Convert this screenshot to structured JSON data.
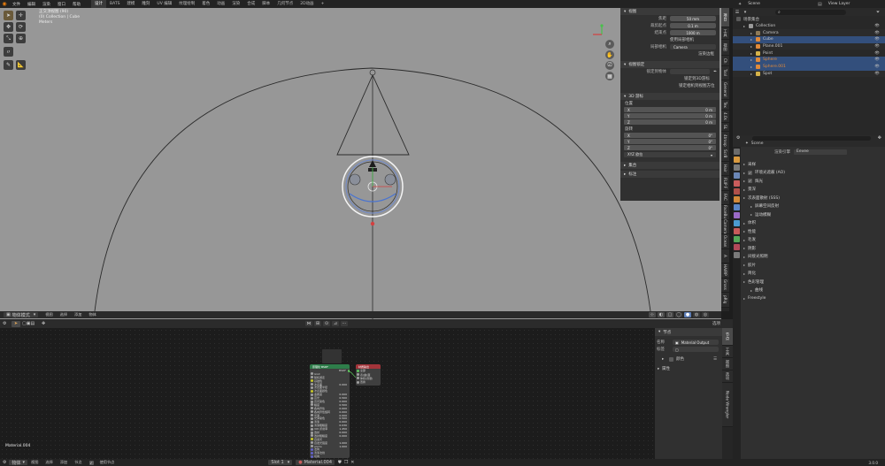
{
  "menu": {
    "logo": "blender-logo",
    "items": [
      "文件",
      "编辑",
      "渲染",
      "窗口",
      "帮助"
    ],
    "workspaces": [
      {
        "label": "设计",
        "active": true
      },
      {
        "label": "BATS",
        "active": false
      },
      {
        "label": "建模",
        "active": false
      },
      {
        "label": "雕刻",
        "active": false
      },
      {
        "label": "UV 编辑",
        "active": false
      },
      {
        "label": "纹理绘制",
        "active": false
      },
      {
        "label": "着色",
        "active": false
      },
      {
        "label": "动画",
        "active": false
      },
      {
        "label": "渲染",
        "active": false
      },
      {
        "label": "合成",
        "active": false
      },
      {
        "label": "脚本",
        "active": false
      },
      {
        "label": "几何节点",
        "active": false
      },
      {
        "label": "2D动画",
        "active": false
      }
    ],
    "add_workspace": "+",
    "scene_name": "Scene",
    "view_layer": "View Layer"
  },
  "viewport": {
    "overlay_lines": [
      "正交顶视图 (90)",
      "(0) Collection | Cube",
      "Meters"
    ],
    "mode_label": "物体模式",
    "header_menus": [
      "视图",
      "选择",
      "添加",
      "物体"
    ],
    "transform_orientation": "全局"
  },
  "npanel": {
    "sections": {
      "view": "视图",
      "view_lock": "视图锁定",
      "cursor": "3D 游标",
      "collections": "集合",
      "annotations": "标注"
    },
    "view_fields": [
      {
        "label": "焦距",
        "value": "50 mm"
      },
      {
        "label": "裁剪起点",
        "value": "0.1 m"
      },
      {
        "label": "结束点",
        "value": "1000 m"
      }
    ],
    "local_camera": "使用局部相机",
    "camera_label": "局部相机",
    "camera_value": "Camera",
    "render_region": "渲染边框",
    "lock_to_object": "锁定到物体",
    "lock_to_cursor": "锁定到3D游标",
    "lock_camera_to_view": "锁定相机到视图方位",
    "location_label": "位置",
    "location": [
      {
        "axis": "X",
        "value": "0 m"
      },
      {
        "axis": "Y",
        "value": "0 m"
      },
      {
        "axis": "Z",
        "value": "0 m"
      }
    ],
    "rotation_label": "旋转",
    "rotation": [
      {
        "axis": "X",
        "value": "0°"
      },
      {
        "axis": "Y",
        "value": "0°"
      },
      {
        "axis": "Z",
        "value": "0°"
      }
    ],
    "rotation_mode": "XYZ 欧拉",
    "tabs": [
      "项目",
      "工具",
      "视图",
      "Ch",
      "Tool",
      "General",
      "Tex",
      "4.0s",
      "SL",
      "4troop"
    ]
  },
  "outliner": {
    "title": "场景集合",
    "items": [
      {
        "label": "Collection",
        "indent": 1,
        "color": "#9a9a9a",
        "selected": false
      },
      {
        "label": "Camera",
        "indent": 2,
        "color": "#8f7a57",
        "selected": false
      },
      {
        "label": "Cube",
        "indent": 2,
        "color": "#e08a3a",
        "selected": true
      },
      {
        "label": "Plane.001",
        "indent": 2,
        "color": "#e08a3a",
        "selected": false
      },
      {
        "label": "Point",
        "indent": 2,
        "color": "#d6b34a",
        "selected": false
      },
      {
        "label": "Sphere",
        "indent": 2,
        "color": "#e08a3a",
        "selected": true
      },
      {
        "label": "Sphere.001",
        "indent": 2,
        "color": "#e08a3a",
        "selected": true
      },
      {
        "label": "Spot",
        "indent": 2,
        "color": "#d6b34a",
        "selected": false
      }
    ]
  },
  "properties": {
    "scene_label": "Scene",
    "engine_label": "渲染引擎",
    "engine_value": "Eevee",
    "rows": [
      {
        "label": "采样",
        "indent": 0,
        "check": false
      },
      {
        "label": "环境光遮蔽 (AO)",
        "indent": 0,
        "check": true
      },
      {
        "label": "辉光",
        "indent": 0,
        "check": true
      },
      {
        "label": "景深",
        "indent": 0,
        "check": false
      },
      {
        "label": "次表面散射 (SSS)",
        "indent": 0,
        "check": false
      },
      {
        "label": "屏幕空间反射",
        "indent": 1,
        "check": false
      },
      {
        "label": "运动模糊",
        "indent": 1,
        "check": false
      },
      {
        "label": "体积",
        "indent": 0,
        "check": false
      },
      {
        "label": "性能",
        "indent": 0,
        "check": false
      },
      {
        "label": "毛发",
        "indent": 0,
        "check": false
      },
      {
        "label": "阴影",
        "indent": 0,
        "check": false
      },
      {
        "label": "间接光照明",
        "indent": 0,
        "check": false
      },
      {
        "label": "胶片",
        "indent": 0,
        "check": false
      },
      {
        "label": "简化",
        "indent": 0,
        "check": false
      },
      {
        "label": "色彩管理",
        "indent": 0,
        "check": false
      },
      {
        "label": "曲线",
        "indent": 1,
        "check": false
      },
      {
        "label": "Freestyle",
        "indent": 0,
        "check": false
      }
    ],
    "side_tabs": [
      "ScrB",
      "Hair",
      "FLIP F",
      "FAC",
      "FaceBu",
      "Camera",
      "Ocean",
      "A",
      "HAIRP",
      "Gross",
      "pRig"
    ]
  },
  "node_editor": {
    "header_menus": [
      "物体",
      "视图",
      "选择",
      "添加",
      "节点"
    ],
    "use_nodes": "使用节点",
    "slot": "Slot 1",
    "material_name": "Material.004",
    "material_label_bottom": "Material.004",
    "sidebar": {
      "section": "节点",
      "name_label": "名称",
      "name_value": "Material Output",
      "label_label": "标签",
      "color_label": "颜色",
      "props_label": "属性"
    },
    "tabs": [
      "节点",
      "工具",
      "视图",
      "选项",
      "Node Wrangler"
    ],
    "bsdf_node": {
      "title": "原理化 BSDF",
      "rows": [
        "BSDF",
        "GGX",
        "随机游走",
        "基础色",
        "次表面",
        "次表面半径",
        "次表面颜色",
        "金属度",
        "高光",
        "高光染色",
        "糙度",
        "各向异性",
        "各向异性旋转",
        "光泽",
        "光泽染色",
        "清漆",
        "清漆粗糙度",
        "IOR 折射率",
        "透射",
        "透射粗糙度",
        "自发光",
        "自发光强度",
        "Alpha",
        "法向",
        "清漆法线",
        "切向"
      ],
      "values": [
        "",
        "",
        "",
        "",
        "0.000",
        "",
        "",
        "0.000",
        "0.500",
        "0.000",
        "0.500",
        "0.000",
        "0.000",
        "0.000",
        "0.500",
        "0.000",
        "0.030",
        "1.450",
        "0.000",
        "0.000",
        "",
        "1.000",
        "1.000",
        "",
        "",
        ""
      ]
    },
    "output_node": {
      "title": "材质输出",
      "rows": [
        "全部",
        "表(曲)面",
        "体积(音量)",
        "置换"
      ]
    }
  },
  "statusbar": {
    "items": [
      "选择",
      "平移视图",
      "节点上下文菜单"
    ],
    "version": "3.0.0"
  },
  "colors": {
    "accent_blue": "#334f7c",
    "viewport_bg": "#979797",
    "node_header_green": "#2e7d4a",
    "node_header_red": "#a3343a"
  }
}
